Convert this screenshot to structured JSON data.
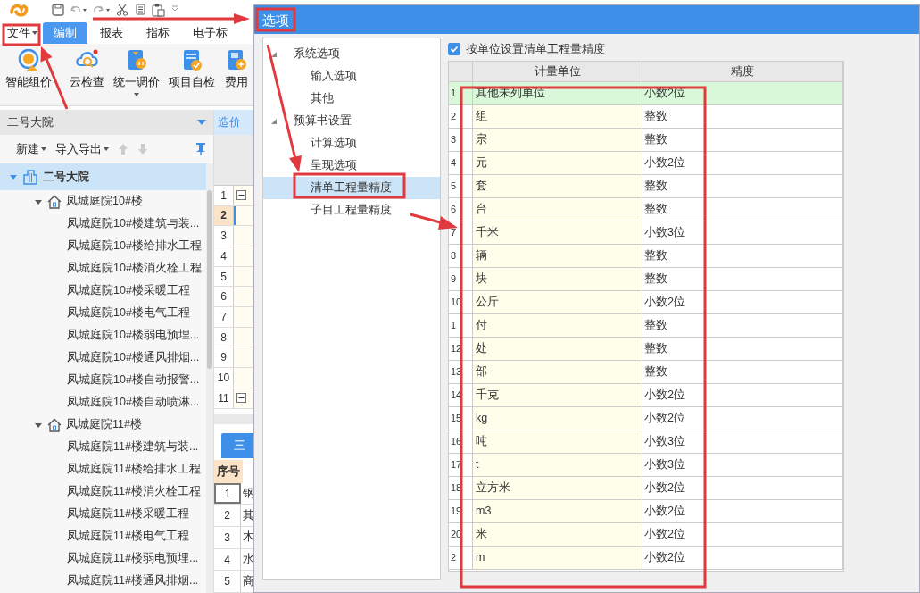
{
  "menu_tabs": [
    {
      "label": "文件",
      "kind": "menu",
      "selected": false
    },
    {
      "label": "编制",
      "kind": "tab",
      "selected": true
    },
    {
      "label": "报表",
      "kind": "tab",
      "selected": false
    },
    {
      "label": "指标",
      "kind": "tab",
      "selected": false
    },
    {
      "label": "电子标",
      "kind": "tab",
      "selected": false
    }
  ],
  "ribbon_buttons": [
    {
      "label": "智能组价",
      "kind": "pricing"
    },
    {
      "label": "云检查",
      "kind": "cloud"
    },
    {
      "label": "统一调价",
      "kind": "adjust",
      "dropdown": true
    },
    {
      "label": "项目自检",
      "kind": "check"
    },
    {
      "label": "费用",
      "kind": "fee"
    }
  ],
  "project_panel": {
    "title": "二号大院",
    "toolbar": [
      {
        "label": "新建",
        "dropdown": true
      },
      {
        "label": "导入导出",
        "dropdown": true
      }
    ],
    "tree": {
      "label": "二号大院",
      "selected": true,
      "expanded": true,
      "children": [
        {
          "label": "凤城庭院10#楼",
          "selected": false,
          "expanded": true,
          "children": [
            {
              "label": "凤城庭院10#楼建筑与装...",
              "selected": false
            },
            {
              "label": "凤城庭院10#楼给排水工程",
              "selected": false
            },
            {
              "label": "凤城庭院10#楼消火栓工程",
              "selected": false
            },
            {
              "label": "凤城庭院10#楼采暖工程",
              "selected": false
            },
            {
              "label": "凤城庭院10#楼电气工程",
              "selected": false
            },
            {
              "label": "凤城庭院10#楼弱电预埋...",
              "selected": false
            },
            {
              "label": "凤城庭院10#楼通风排烟...",
              "selected": false
            },
            {
              "label": "凤城庭院10#楼自动报警...",
              "selected": false
            },
            {
              "label": "凤城庭院10#楼自动喷淋...",
              "selected": false
            }
          ]
        },
        {
          "label": "凤城庭院11#楼",
          "selected": false,
          "expanded": true,
          "children": [
            {
              "label": "凤城庭院11#楼建筑与装...",
              "selected": false
            },
            {
              "label": "凤城庭院11#楼给排水工程",
              "selected": false
            },
            {
              "label": "凤城庭院11#楼消火栓工程",
              "selected": false
            },
            {
              "label": "凤城庭院11#楼采暖工程",
              "selected": false
            },
            {
              "label": "凤城庭院11#楼电气工程",
              "selected": false
            },
            {
              "label": "凤城庭院11#楼弱电预埋...",
              "selected": false
            },
            {
              "label": "凤城庭院11#楼通风排烟...",
              "selected": false
            }
          ]
        }
      ]
    }
  },
  "grid": {
    "tab": "造价",
    "rows": [
      {
        "number": "1",
        "selected": false,
        "group": true,
        "expanded": true
      },
      {
        "number": "2",
        "selected": true,
        "group": false
      },
      {
        "number": "3",
        "selected": false,
        "group": false
      },
      {
        "number": "4",
        "selected": false,
        "group": false
      },
      {
        "number": "5",
        "selected": false,
        "group": false
      },
      {
        "number": "6",
        "selected": false,
        "group": false
      },
      {
        "number": "7",
        "selected": false,
        "group": false
      },
      {
        "number": "8",
        "selected": false,
        "group": false
      },
      {
        "number": "9",
        "selected": false,
        "group": false
      },
      {
        "number": "10",
        "selected": false,
        "group": false
      },
      {
        "number": "11",
        "selected": false,
        "group": true,
        "expanded": true
      }
    ]
  },
  "lower_panel": {
    "tab": "三",
    "column": "序号",
    "rows": [
      {
        "number": "1",
        "text": "钢",
        "selected": true
      },
      {
        "number": "2",
        "text": "其",
        "selected": false
      },
      {
        "number": "3",
        "text": "木",
        "selected": false
      },
      {
        "number": "4",
        "text": "水",
        "selected": false
      },
      {
        "number": "5",
        "text": "商",
        "selected": false
      }
    ]
  },
  "dialog": {
    "title": "选项",
    "nav": [
      {
        "label": "系统选项",
        "expanded": true,
        "selected": false,
        "children": [
          {
            "label": "输入选项",
            "selected": false
          },
          {
            "label": "其他",
            "selected": false
          }
        ]
      },
      {
        "label": "预算书设置",
        "expanded": true,
        "selected": false,
        "children": [
          {
            "label": "计算选项",
            "selected": false
          },
          {
            "label": "呈现选项",
            "selected": false
          },
          {
            "label": "清单工程量精度",
            "selected": true
          },
          {
            "label": "子目工程量精度",
            "selected": false
          }
        ]
      }
    ],
    "option": {
      "label": "按单位设置清单工程量精度",
      "checked": true
    },
    "table": {
      "columns": [
        "计量单位",
        "精度"
      ],
      "rows": [
        {
          "number": "1",
          "unit": "其他未列单位",
          "precision": "小数2位",
          "selected": true
        },
        {
          "number": "2",
          "unit": "组",
          "precision": "整数",
          "selected": false
        },
        {
          "number": "3",
          "unit": "宗",
          "precision": "整数",
          "selected": false
        },
        {
          "number": "4",
          "unit": "元",
          "precision": "小数2位",
          "selected": false
        },
        {
          "number": "5",
          "unit": "套",
          "precision": "整数",
          "selected": false
        },
        {
          "number": "6",
          "unit": "台",
          "precision": "整数",
          "selected": false
        },
        {
          "number": "7",
          "unit": "千米",
          "precision": "小数3位",
          "selected": false
        },
        {
          "number": "8",
          "unit": "辆",
          "precision": "整数",
          "selected": false
        },
        {
          "number": "9",
          "unit": "块",
          "precision": "整数",
          "selected": false
        },
        {
          "number": "10",
          "unit": "公斤",
          "precision": "小数2位",
          "selected": false
        },
        {
          "number": "1",
          "unit": "付",
          "precision": "整数",
          "selected": false
        },
        {
          "number": "12",
          "unit": "处",
          "precision": "整数",
          "selected": false
        },
        {
          "number": "13",
          "unit": "部",
          "precision": "整数",
          "selected": false
        },
        {
          "number": "14",
          "unit": "千克",
          "precision": "小数2位",
          "selected": false
        },
        {
          "number": "15",
          "unit": "kg",
          "precision": "小数2位",
          "selected": false
        },
        {
          "number": "16",
          "unit": "吨",
          "precision": "小数3位",
          "selected": false
        },
        {
          "number": "17",
          "unit": "t",
          "precision": "小数3位",
          "selected": false
        },
        {
          "number": "18",
          "unit": "立方米",
          "precision": "小数2位",
          "selected": false
        },
        {
          "number": "19",
          "unit": "m3",
          "precision": "小数2位",
          "selected": false
        },
        {
          "number": "20",
          "unit": "米",
          "precision": "小数2位",
          "selected": false
        },
        {
          "number": "2",
          "unit": "m",
          "precision": "小数2位",
          "selected": false
        }
      ]
    }
  }
}
